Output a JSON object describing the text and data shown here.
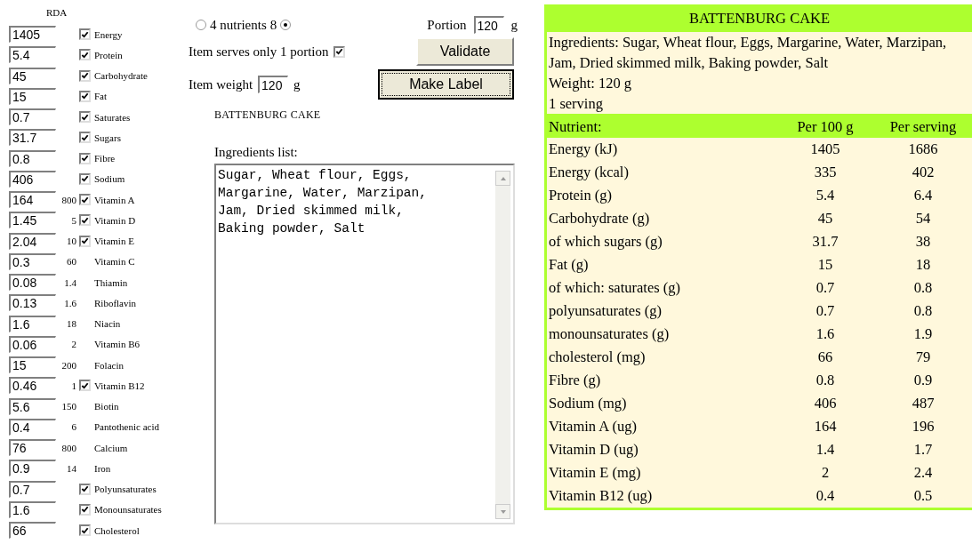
{
  "rda_heading": "RDA",
  "nutrients": [
    {
      "value": "1405",
      "kind": "check",
      "checked": true,
      "label": "Energy"
    },
    {
      "value": "5.4",
      "kind": "check",
      "checked": true,
      "label": "Protein"
    },
    {
      "value": "45",
      "kind": "check",
      "checked": true,
      "label": "Carbohydrate"
    },
    {
      "value": "15",
      "kind": "check",
      "checked": true,
      "label": "Fat"
    },
    {
      "value": "0.7",
      "kind": "check",
      "checked": true,
      "label": "Saturates"
    },
    {
      "value": "31.7",
      "kind": "check",
      "checked": true,
      "label": "Sugars"
    },
    {
      "value": "0.8",
      "kind": "check",
      "checked": true,
      "label": "Fibre"
    },
    {
      "value": "406",
      "kind": "check",
      "checked": true,
      "label": "Sodium"
    },
    {
      "value": "164",
      "rda": "800",
      "kind": "check",
      "checked": true,
      "label": "Vitamin A"
    },
    {
      "value": "1.45",
      "rda": "5",
      "kind": "check",
      "checked": true,
      "label": "Vitamin D"
    },
    {
      "value": "2.04",
      "rda": "10",
      "kind": "check",
      "checked": true,
      "label": "Vitamin E"
    },
    {
      "value": "0.3",
      "rda": "60",
      "kind": "plain",
      "label": "Vitamin C"
    },
    {
      "value": "0.08",
      "rda": "1.4",
      "kind": "plain",
      "label": "Thiamin"
    },
    {
      "value": "0.13",
      "rda": "1.6",
      "kind": "plain",
      "label": "Riboflavin"
    },
    {
      "value": "1.6",
      "rda": "18",
      "kind": "plain",
      "label": "Niacin"
    },
    {
      "value": "0.06",
      "rda": "2",
      "kind": "plain",
      "label": "Vitamin B6"
    },
    {
      "value": "15",
      "rda": "200",
      "kind": "plain",
      "label": "Folacin"
    },
    {
      "value": "0.46",
      "rda": "1",
      "kind": "check",
      "checked": true,
      "label": "Vitamin B12"
    },
    {
      "value": "5.6",
      "rda": "150",
      "kind": "plain",
      "label": "Biotin"
    },
    {
      "value": "0.4",
      "rda": "6",
      "kind": "plain",
      "label": "Pantothenic acid"
    },
    {
      "value": "76",
      "rda": "800",
      "kind": "plain",
      "label": "Calcium"
    },
    {
      "value": "0.9",
      "rda": "14",
      "kind": "plain",
      "label": "Iron"
    },
    {
      "value": "0.7",
      "kind": "check",
      "checked": true,
      "label": "Polyunsaturates"
    },
    {
      "value": "1.6",
      "kind": "check",
      "checked": true,
      "label": "Monounsaturates"
    },
    {
      "value": "66",
      "kind": "check",
      "checked": true,
      "label": "Cholesterol"
    }
  ],
  "mode": [
    {
      "label": "4 nutrients",
      "selected": false
    },
    {
      "label": "8",
      "selected": true
    }
  ],
  "portion": {
    "label": "Portion",
    "value": "120",
    "unit": "g"
  },
  "single_portion": {
    "label": "Item serves only 1 portion",
    "checked": true
  },
  "item_weight": {
    "label": "Item weight",
    "value": "120",
    "unit": "g"
  },
  "buttons": [
    {
      "label": "Validate",
      "focused": false
    },
    {
      "label": "Make Label",
      "focused": true
    }
  ],
  "product_name": "BATTENBURG CAKE",
  "ingredients": {
    "label": "Ingredients list:",
    "value": "Sugar, Wheat flour, Eggs,\nMargarine, Water, Marzipan,\nJam, Dried skimmed milk,\nBaking powder, Salt"
  },
  "label": {
    "title": "BATTENBURG CAKE",
    "info": [
      "Ingredients: Sugar, Wheat flour, Eggs, Margarine, Water, Marzipan, Jam, Dried skimmed milk, Baking powder, Salt",
      "Weight: 120 g",
      "1 serving"
    ],
    "columns": [
      "Nutrient:",
      "Per 100 g",
      "Per serving"
    ],
    "rows": [
      [
        "Energy (kJ)",
        "1405",
        "1686"
      ],
      [
        "Energy (kcal)",
        "335",
        "402"
      ],
      [
        "Protein (g)",
        "5.4",
        "6.4"
      ],
      [
        "Carbohydrate (g)",
        "45",
        "54"
      ],
      [
        "of which sugars (g)",
        "31.7",
        "38"
      ],
      [
        "Fat (g)",
        "15",
        "18"
      ],
      [
        "of which: saturates (g)",
        "0.7",
        "0.8"
      ],
      [
        "polyunsaturates (g)",
        "0.7",
        "0.8"
      ],
      [
        "monounsaturates (g)",
        "1.6",
        "1.9"
      ],
      [
        "cholesterol (mg)",
        "66",
        "79"
      ],
      [
        "Fibre (g)",
        "0.8",
        "0.9"
      ],
      [
        "Sodium (mg)",
        "406",
        "487"
      ],
      [
        "Vitamin A (ug)",
        "164",
        "196"
      ],
      [
        "Vitamin D (ug)",
        "1.4",
        "1.7"
      ],
      [
        "Vitamin E (mg)",
        "2",
        "2.4"
      ],
      [
        "Vitamin B12 (ug)",
        "0.4",
        "0.5"
      ]
    ]
  }
}
